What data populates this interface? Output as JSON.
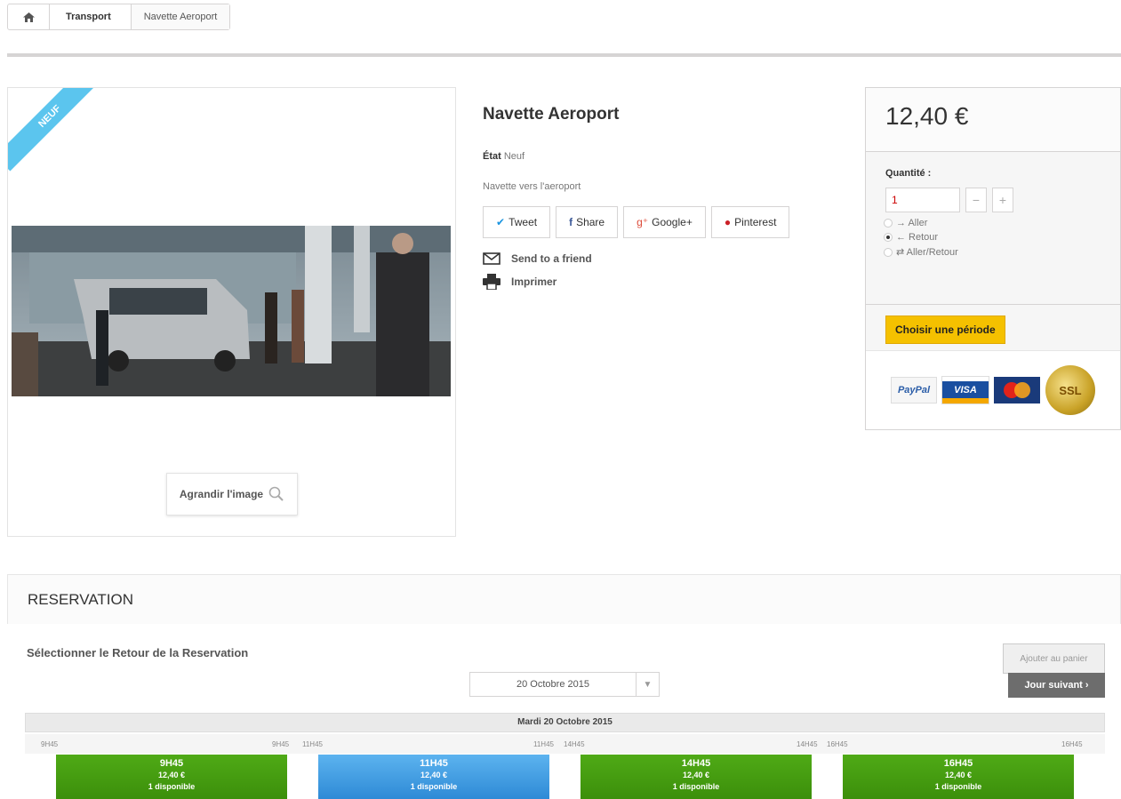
{
  "breadcrumb": {
    "items": [
      "Transport",
      "Navette Aeroport"
    ]
  },
  "product": {
    "badge": "NEUF",
    "zoom_label": "Agrandir l'image",
    "title": "Navette Aeroport",
    "etat_label": "État",
    "etat_value": "Neuf",
    "description": "Navette vers l'aeroport",
    "social": [
      "Tweet",
      "Share",
      "Google+",
      "Pinterest"
    ],
    "send_friend": "Send to a friend",
    "print": "Imprimer"
  },
  "buy": {
    "price": "12,40 €",
    "quantity_label": "Quantité :",
    "quantity_value": "1",
    "options": [
      {
        "label": "→ Aller",
        "selected": false
      },
      {
        "label": "← Retour",
        "selected": true
      },
      {
        "label": "⇄ Aller/Retour",
        "selected": false
      }
    ],
    "choose_period": "Choisir une période",
    "payments": [
      "PayPal",
      "VISA",
      "MasterCard",
      "SSL"
    ]
  },
  "reservation": {
    "title": "RESERVATION",
    "subtitle": "Sélectionner le Retour de la Reservation",
    "add_to_cart": "Ajouter au panier",
    "next_day": "Jour suivant ›",
    "date": "20 Octobre 2015",
    "day_header": "Mardi 20 Octobre 2015",
    "time_marks": [
      "9H45",
      "9H45",
      "11H45",
      "11H45",
      "14H45",
      "14H45",
      "16H45",
      "16H45"
    ],
    "slots": [
      {
        "time": "9H45",
        "price": "12,40 €",
        "availability": "1 disponible",
        "color": "green"
      },
      {
        "time": "11H45",
        "price": "12,40 €",
        "availability": "1 disponible",
        "color": "blue"
      },
      {
        "time": "14H45",
        "price": "12,40 €",
        "availability": "1 disponible",
        "color": "green"
      },
      {
        "time": "16H45",
        "price": "12,40 €",
        "availability": "1 disponible",
        "color": "green"
      }
    ]
  }
}
